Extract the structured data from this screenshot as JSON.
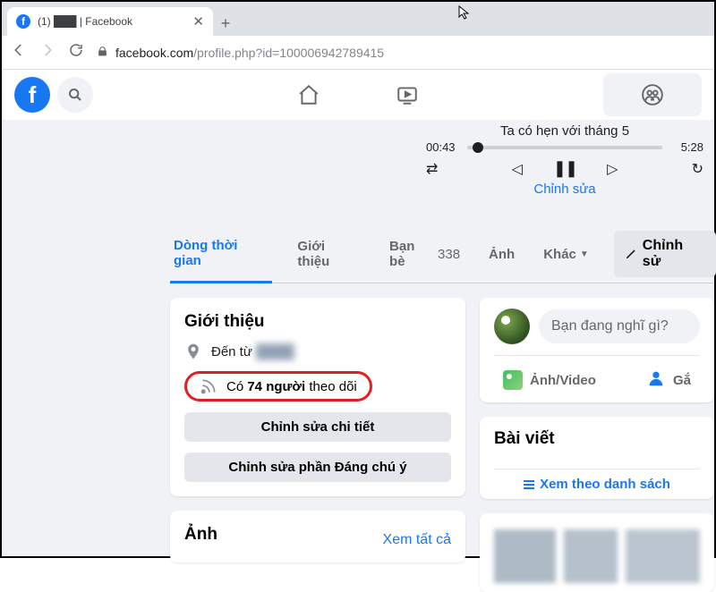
{
  "browser": {
    "tab_title": "(1) ███ | Facebook",
    "url_host": "facebook.com",
    "url_path": "/profile.php?id=100006942789415"
  },
  "player": {
    "title": "Ta có hẹn với tháng 5",
    "time_current": "00:43",
    "time_total": "5:28",
    "edit_label": "Chỉnh sửa"
  },
  "tabs": {
    "timeline": "Dòng thời gian",
    "about": "Giới thiệu",
    "friends": "Bạn bè",
    "friends_count": "338",
    "photos": "Ảnh",
    "more": "Khác",
    "edit_button": "Chỉnh sử"
  },
  "intro": {
    "heading": "Giới thiệu",
    "from_label": "Đến từ",
    "from_value": "████",
    "followers_prefix": "Có ",
    "followers_count": "74 người",
    "followers_suffix": " theo dõi",
    "edit_details": "Chỉnh sửa chi tiết",
    "edit_featured": "Chỉnh sửa phần Đáng chú ý"
  },
  "composer": {
    "placeholder": "Bạn đang nghĩ gì?",
    "media_label": "Ảnh/Video",
    "tag_label": "Gắ"
  },
  "posts": {
    "heading": "Bài viết",
    "view_list": "Xem theo danh sách"
  },
  "photos": {
    "heading": "Ảnh",
    "see_all": "Xem tất cả"
  }
}
